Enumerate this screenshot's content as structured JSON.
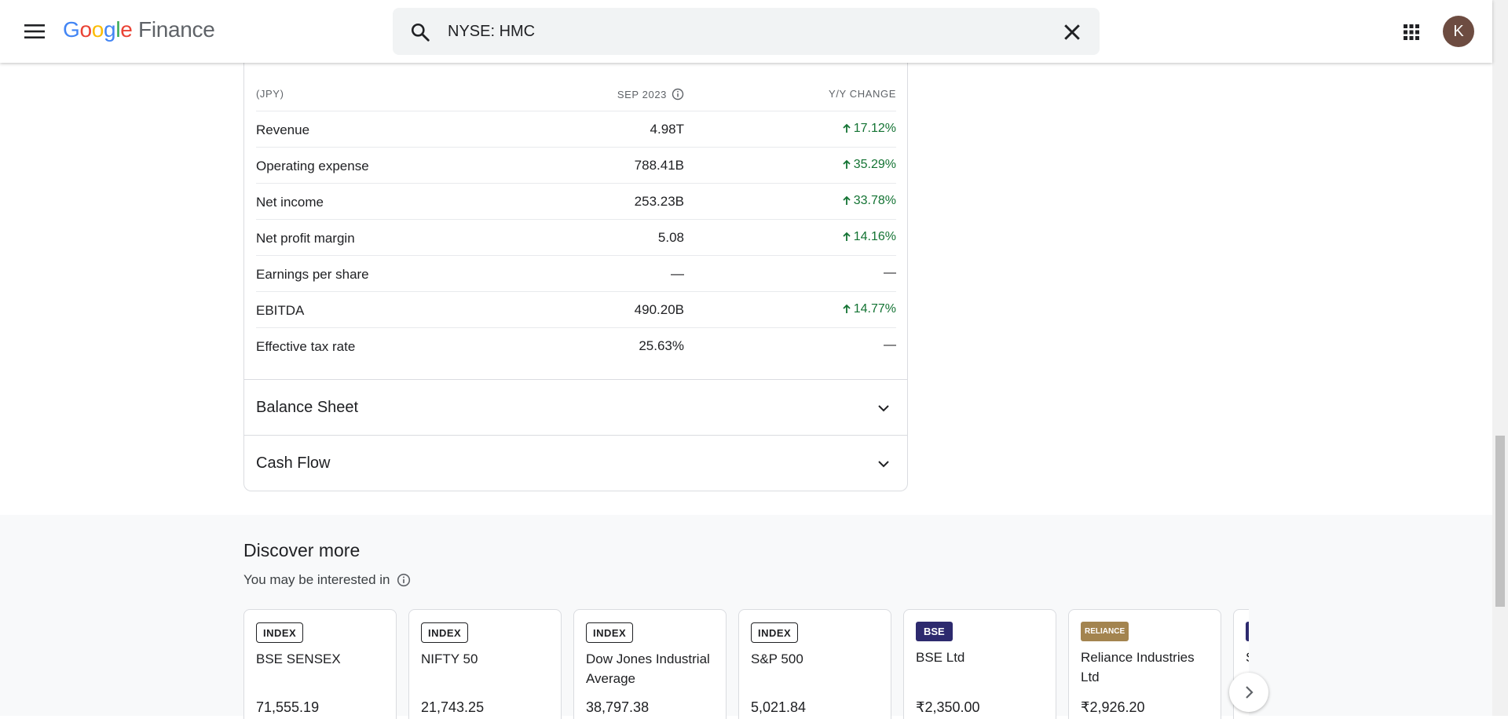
{
  "header": {
    "logo_parts": [
      "G",
      "o",
      "o",
      "g",
      "l",
      "e"
    ],
    "logo_suffix": "Finance",
    "search_value": "NYSE: HMC"
  },
  "avatar_initial": "K",
  "income": {
    "header": {
      "currency": "(JPY)",
      "period": "SEP 2023",
      "change": "Y/Y CHANGE"
    },
    "rows": [
      {
        "label": "Revenue",
        "value": "4.98T",
        "change": "17.12%",
        "up": true
      },
      {
        "label": "Operating expense",
        "value": "788.41B",
        "change": "35.29%",
        "up": true
      },
      {
        "label": "Net income",
        "value": "253.23B",
        "change": "33.78%",
        "up": true
      },
      {
        "label": "Net profit margin",
        "value": "5.08",
        "change": "14.16%",
        "up": true
      },
      {
        "label": "Earnings per share",
        "value": "—",
        "change": "—",
        "up": false
      },
      {
        "label": "EBITDA",
        "value": "490.20B",
        "change": "14.77%",
        "up": true
      },
      {
        "label": "Effective tax rate",
        "value": "25.63%",
        "change": "—",
        "up": false
      }
    ]
  },
  "sections": {
    "balance_sheet": "Balance Sheet",
    "cash_flow": "Cash Flow"
  },
  "discover": {
    "title": "Discover more",
    "subtitle": "You may be interested in",
    "tiles": [
      {
        "badge": "INDEX",
        "name": "BSE SENSEX",
        "price": "71,555.19"
      },
      {
        "badge": "INDEX",
        "name": "NIFTY 50",
        "price": "21,743.25"
      },
      {
        "badge": "INDEX",
        "name": "Dow Jones Industrial Average",
        "price": "38,797.38"
      },
      {
        "badge": "INDEX",
        "name": "S&P 500",
        "price": "5,021.84"
      },
      {
        "badge": "BSE",
        "name": "BSE Ltd",
        "price": "₹2,350.00"
      },
      {
        "badge": "RELIANCE",
        "name": "Reliance Industries Ltd",
        "price": "₹2,926.20"
      },
      {
        "badge": "",
        "name": "S",
        "price": ""
      }
    ]
  },
  "colors": {
    "up_green": "#137333",
    "bse_badge": "#2d2a6e",
    "reliance_badge": "#a3844f"
  }
}
